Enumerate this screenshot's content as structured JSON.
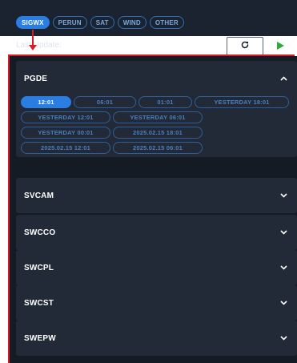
{
  "tabs": [
    {
      "label": "SIGWX",
      "active": true
    },
    {
      "label": "PERUN",
      "active": false
    },
    {
      "label": "SAT",
      "active": false
    },
    {
      "label": "WIND",
      "active": false
    },
    {
      "label": "OTHER",
      "active": false
    }
  ],
  "status": {
    "last_update_label": "Last Update:",
    "last_update_value": "UTC 17:01:34"
  },
  "controls": {
    "refresh_icon": "refresh-icon",
    "play_icon": "play-icon",
    "play_color": "#2eaa3c"
  },
  "annotation_color": "#d21e2a",
  "accordions": [
    {
      "title": "PGDE",
      "expanded": true,
      "times": [
        [
          "12:01",
          "06:01",
          "01:01",
          "YESTERDAY 18:01"
        ],
        [
          "YESTERDAY 12:01",
          "YESTERDAY 06:01"
        ],
        [
          "YESTERDAY 00:01",
          "2025.02.15 18:01"
        ],
        [
          "2025.02.15 12:01",
          "2025.02.15 06:01"
        ]
      ],
      "selected_time": "12:01"
    },
    {
      "title": "SVCAM",
      "expanded": false
    },
    {
      "title": "SWCCO",
      "expanded": false
    },
    {
      "title": "SWCPL",
      "expanded": false
    },
    {
      "title": "SWCST",
      "expanded": false
    },
    {
      "title": "SWEPW",
      "expanded": false
    }
  ]
}
